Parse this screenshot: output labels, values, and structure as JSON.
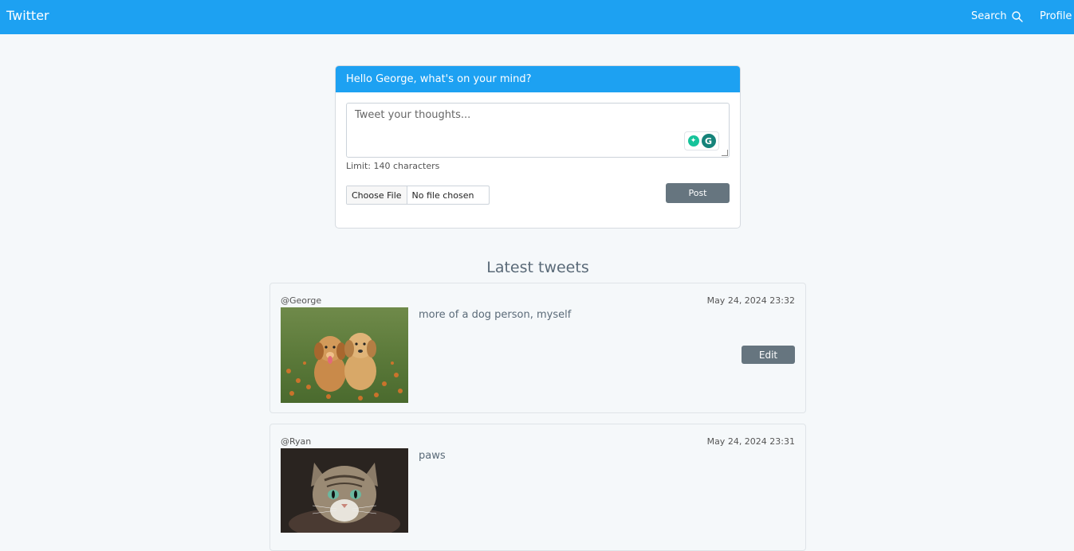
{
  "navbar": {
    "brand": "Twitter",
    "search_label": "Search",
    "profile_label": "Profile",
    "accent_color": "#1da1f2"
  },
  "compose": {
    "header": "Hello George, what's on your mind?",
    "placeholder": "Tweet your thoughts...",
    "limit_text": "Limit: 140 characters",
    "file_button": "Choose File",
    "file_status": "No file chosen",
    "post_label": "Post"
  },
  "feed": {
    "title": "Latest tweets",
    "tweets": [
      {
        "handle": "@George",
        "timestamp": "May 24, 2024 23:32",
        "text": "more of a dog person, myself",
        "image": "puppies-photo",
        "edit_label": "Edit"
      },
      {
        "handle": "@Ryan",
        "timestamp": "May 24, 2024 23:31",
        "text": "paws",
        "image": "cat-photo"
      }
    ]
  },
  "icons": {
    "search": "search-icon",
    "grammarly": "grammarly-icon"
  }
}
